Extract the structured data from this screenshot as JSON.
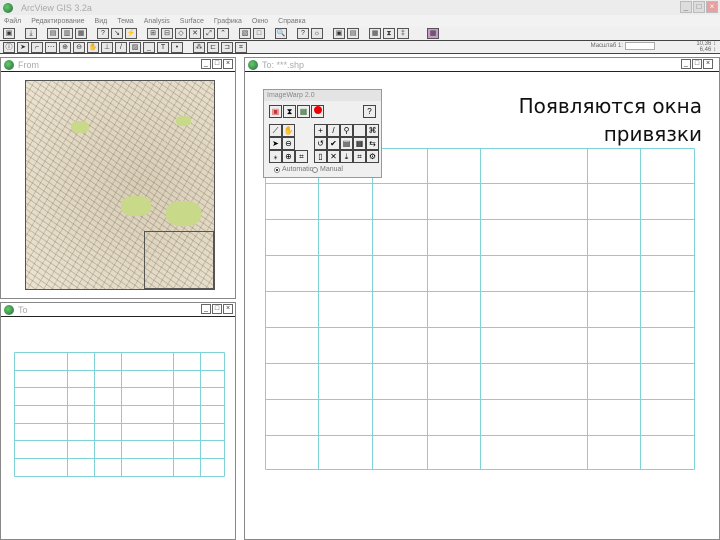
{
  "app": {
    "title": "ArcView GIS 3.2a"
  },
  "menu": [
    "Файл",
    "Редактирование",
    "Вид",
    "Тема",
    "Analysis",
    "Surface",
    "Графика",
    "Окно",
    "Справка"
  ],
  "toolbar": {
    "scale_label": "Масштаб 1:",
    "scale_value": "",
    "coords": [
      "10,36 ↕",
      "6,46 ↕"
    ]
  },
  "windows": {
    "from": {
      "title": "From"
    },
    "to_shp": {
      "title": "To: ***.shp"
    },
    "to": {
      "title": "To"
    }
  },
  "image_warp": {
    "title": "ImageWarp 2.0",
    "help": "?",
    "modes": [
      {
        "label": "Automatic",
        "selected": true
      },
      {
        "label": "Manual",
        "selected": false
      }
    ]
  },
  "caption": {
    "line1": "Появляются окна",
    "line2": "привязки"
  }
}
